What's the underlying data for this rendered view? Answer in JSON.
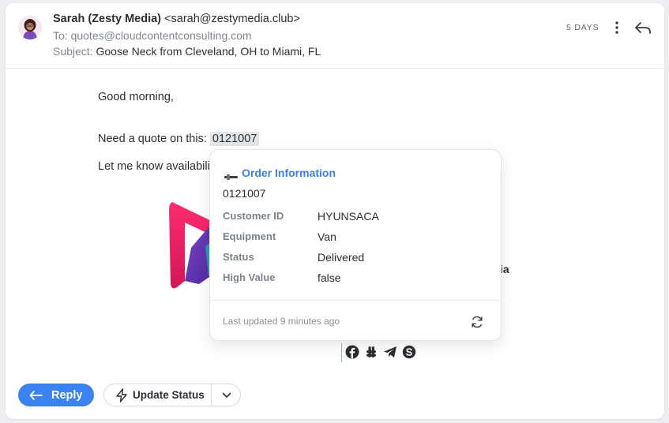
{
  "header": {
    "sender_name": "Sarah (Zesty Media)",
    "sender_email": "<sarah@zestymedia.club>",
    "to_label": "To:",
    "to_value": "quotes@cloudcontentconsulting.com",
    "subject_label": "Subject:",
    "subject_value": "Goose Neck from Cleveland, OH to Miami, FL",
    "time": "5 DAYS",
    "icons": [
      "avatar",
      "more-vertical-icon",
      "reply-icon"
    ]
  },
  "body": {
    "greeting": "Good morning,",
    "quote_prefix": "Need a quote on this: ",
    "quote_number": "0121007",
    "availability": "Let me know availabili",
    "signature_tail": "ia",
    "social_icons": [
      "facebook-icon",
      "slack-icon",
      "telegram-icon",
      "skype-icon"
    ]
  },
  "popover": {
    "title": "Order Information",
    "order_id": "0121007",
    "fields": [
      {
        "label": "Customer ID",
        "value": "HYUNSACA"
      },
      {
        "label": "Equipment",
        "value": "Van"
      },
      {
        "label": "Status",
        "value": "Delivered"
      },
      {
        "label": "High Value",
        "value": "false"
      }
    ],
    "last_updated": "Last updated 9 minutes ago"
  },
  "actions": {
    "reply_label": "Reply",
    "update_status_label": "Update Status"
  },
  "colors": {
    "accent": "#3b82f0",
    "link": "#3f7fdd",
    "highlight": "#e3e5e8"
  }
}
